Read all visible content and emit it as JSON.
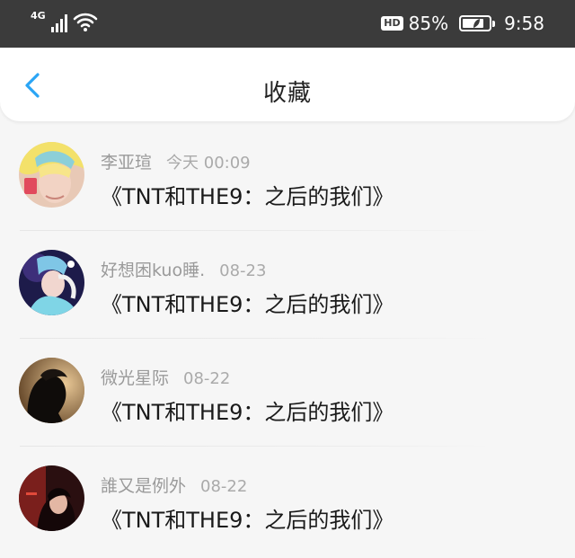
{
  "status_bar": {
    "network": "4G",
    "signal_icon": "signal-bars-icon",
    "wifi_icon": "wifi-icon",
    "hd_badge": "HD",
    "battery_percent": "85%",
    "battery_level": 0.85,
    "time": "9:58"
  },
  "header": {
    "back_icon": "chevron-left-icon",
    "title": "收藏",
    "accent_color": "#2aa5f5"
  },
  "favorites": [
    {
      "user": "李亚瑄",
      "time": "今天 00:09",
      "title": "《TNT和THE9：之后的我们》"
    },
    {
      "user": "好想困kuo睡.",
      "time": "08-23",
      "title": "《TNT和THE9：之后的我们》"
    },
    {
      "user": "微光星际",
      "time": "08-22",
      "title": "《TNT和THE9：之后的我们》"
    },
    {
      "user": "誰又是例外",
      "time": "08-22",
      "title": "《TNT和THE9：之后的我们》"
    }
  ]
}
